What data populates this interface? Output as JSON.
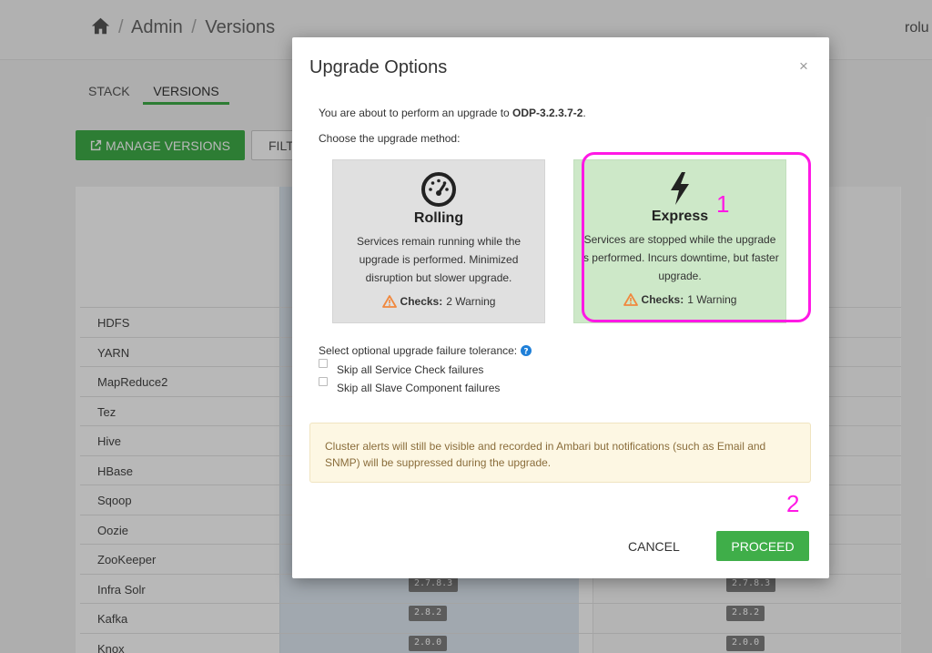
{
  "breadcrumb": {
    "items": [
      "Admin",
      "Versions"
    ],
    "separator": "/"
  },
  "header": {
    "user": "rolu"
  },
  "tabs": {
    "stack": "STACK",
    "versions": "VERSIONS"
  },
  "toolbar": {
    "manage_label": "MANAGE VERSIONS",
    "filter_label": "FILT"
  },
  "services": [
    {
      "name": "HDFS"
    },
    {
      "name": "YARN"
    },
    {
      "name": "MapReduce2"
    },
    {
      "name": "Tez"
    },
    {
      "name": "Hive"
    },
    {
      "name": "HBase"
    },
    {
      "name": "Sqoop"
    },
    {
      "name": "Oozie"
    },
    {
      "name": "ZooKeeper"
    },
    {
      "name": "Infra Solr",
      "current": "2.7.8.3",
      "target": "2.7.8.3"
    },
    {
      "name": "Kafka",
      "current": "2.8.2",
      "target": "2.8.2"
    },
    {
      "name": "Knox",
      "current": "2.0.0",
      "target": "2.0.0"
    }
  ],
  "modal": {
    "title": "Upgrade Options",
    "close": "×",
    "intro_prefix": "You are about to perform an upgrade to ",
    "target_version": "ODP-3.2.3.7-2",
    "intro_suffix": ".",
    "choose_label": "Choose the upgrade method:",
    "options": [
      {
        "name": "Rolling",
        "icon": "gauge-icon",
        "description": "Services remain running while the upgrade is performed. Minimized disruption but slower upgrade.",
        "checks_label": "Checks:",
        "checks_value": "2 Warning"
      },
      {
        "name": "Express",
        "icon": "lightning-icon",
        "description": "Services are stopped while the upgrade is performed. Incurs downtime, but faster upgrade.",
        "checks_label": "Checks:",
        "checks_value": "1 Warning"
      }
    ],
    "tolerance_label": "Select optional upgrade failure tolerance:",
    "skip_service_check": "Skip all Service Check failures",
    "skip_slave_component": "Skip all Slave Component failures",
    "alert_text": "Cluster alerts will still be visible and recorded in Ambari but notifications (such as Email and SNMP) will be suppressed during the upgrade.",
    "cancel_label": "CANCEL",
    "proceed_label": "PROCEED"
  },
  "annotations": {
    "first": "1",
    "second": "2"
  },
  "colors": {
    "accent": "#3fae49",
    "annotation": "#ff19e5",
    "warning": "#f0883e",
    "alert_bg": "#fdf7e3",
    "express_bg": "#cde8c8"
  }
}
